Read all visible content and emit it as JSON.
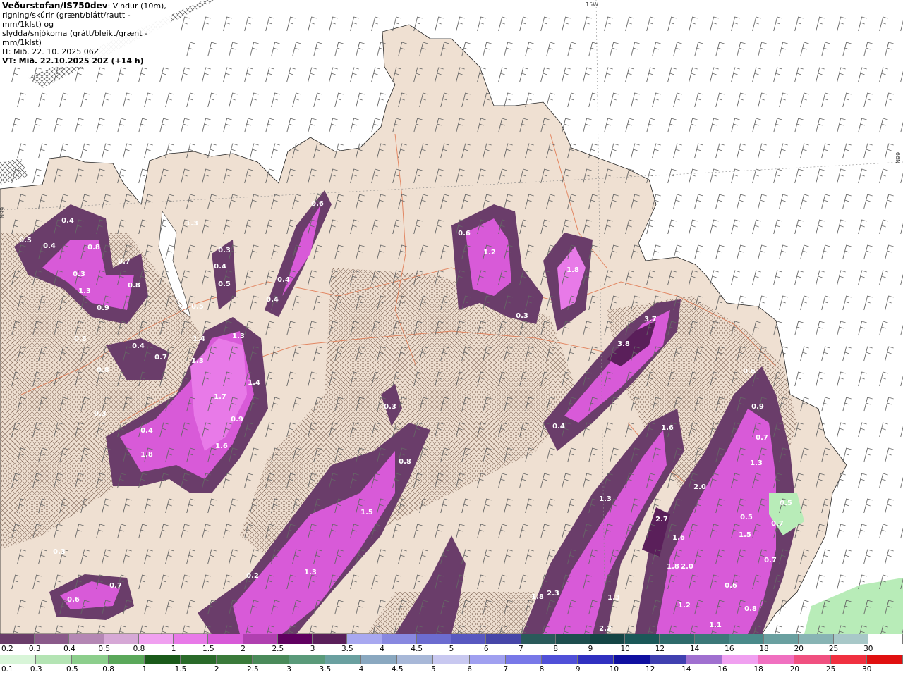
{
  "header": {
    "brand": "Veðurstofan/IS750dev",
    "desc_1": ": Vindur (10m),",
    "desc_2": "rigning/skúrir (grænt/blátt/rautt - mm/1klst) og",
    "desc_3": "slydda/snjókoma (grátt/bleikt/grænt - mm/1klst)",
    "it_line": "IT: Mið. 22. 10. 2025 06Z",
    "vt_line": "VT: Mið. 22.10.2025 20Z (+14 h)"
  },
  "grid_labels": {
    "lon_15w": "15W",
    "lat_66n_left": "N99",
    "lat_66n_right": "N99"
  },
  "map_values": [
    "0.5",
    "0.4",
    "0.4",
    "0.8",
    "0.3",
    "0.7",
    "0.8",
    "1.3",
    "0.9",
    "0.8",
    "0.4",
    "0.7",
    "0.8",
    "0.3",
    "0.4",
    "1.8",
    "1.4",
    "1.3",
    "1.3",
    "1.4",
    "1.7",
    "0.9",
    "1.6",
    "1.3",
    "0.3",
    "0.4",
    "0.5",
    "0.5",
    "0.4",
    "0.4",
    "0.6",
    "0.3",
    "0.8",
    "1.5",
    "1.3",
    "0.2",
    "0.6",
    "0.7",
    "0.3",
    "0.6",
    "1.2",
    "1.8",
    "0.3",
    "3.7",
    "3.8",
    "0.4",
    "1.6",
    "1.3",
    "2.7",
    "1.6",
    "1.8",
    "2.0",
    "1.3",
    "2.3",
    "1.8",
    "1.2",
    "2.0",
    "0.6",
    "0.9",
    "0.7",
    "1.3",
    "0.5",
    "0.5",
    "0.7",
    "1.5",
    "0.7",
    "0.6",
    "0.8",
    "1.1",
    "2.2"
  ],
  "colors": {
    "land": "#efe0d2",
    "sea": "#ffffff",
    "snow_light": "#a86aa8",
    "snow_mid": "#c050c8",
    "snow_high": "#e070ec",
    "snow_dark": "#5a2060",
    "rain_green": "#b8ecb8",
    "roads": "#e07850"
  },
  "scale_snow": {
    "labels": [
      "0.2",
      "0.3",
      "0.4",
      "0.5",
      "0.8",
      "1",
      "1.5",
      "2",
      "2.5",
      "3",
      "3.5",
      "4",
      "4.5",
      "5",
      "6",
      "7",
      "8",
      "9",
      "10",
      "12",
      "14",
      "16",
      "18",
      "20",
      "25",
      "30"
    ],
    "colors": [
      "#6a3d6a",
      "#8a5a8a",
      "#b487b4",
      "#d6a8d6",
      "#f0a0f0",
      "#e87ae8",
      "#d85ad8",
      "#b040b0",
      "#600060",
      "#5a1f5a",
      "#a8a8f0",
      "#8888e0",
      "#6c6cd0",
      "#5858c0",
      "#4646a8",
      "#2a5a5a",
      "#1e4e4e",
      "#154545",
      "#1b5858",
      "#2e6b6b",
      "#3c7878",
      "#4a8a8a",
      "#6aa0a0",
      "#88b4b4",
      "#a8c8c8",
      "#ffffff"
    ]
  },
  "scale_rain": {
    "labels": [
      "0.1",
      "0.3",
      "0.5",
      "0.8",
      "1",
      "1.5",
      "2",
      "2.5",
      "3",
      "3.5",
      "4",
      "4.5",
      "5",
      "6",
      "7",
      "8",
      "9",
      "10",
      "12",
      "14",
      "16",
      "18",
      "20",
      "25",
      "30"
    ],
    "colors": [
      "#d8f5d8",
      "#b4e4b4",
      "#8cce8c",
      "#5aa85a",
      "#1a5a1a",
      "#2a6a2a",
      "#3a7a3a",
      "#4a8a5a",
      "#5a9a7a",
      "#6aa0a0",
      "#8aa8c0",
      "#a8b8d8",
      "#c8c8f0",
      "#a0a0f0",
      "#7878e8",
      "#5050d8",
      "#3030c0",
      "#1010a0",
      "#4040b0",
      "#a070d0",
      "#f0a0f0",
      "#f070c0",
      "#f05080",
      "#f03040",
      "#e01010"
    ]
  }
}
